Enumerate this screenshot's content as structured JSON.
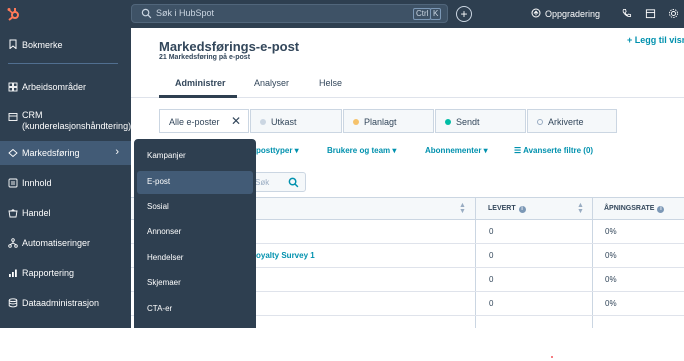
{
  "topbar": {
    "logo_icon": "hubspot-sprocket-icon",
    "search_placeholder": "Søk i HubSpot",
    "shortcut_keys": [
      "Ctrl",
      "K"
    ],
    "upgrade_label": "Oppgradering",
    "icons": [
      "plus-icon",
      "phone-icon",
      "marketplace-icon"
    ]
  },
  "sidebar": {
    "items": [
      {
        "label": "Bokmerke",
        "icon": "bookmark-icon"
      },
      {
        "label": "Arbeidsområder",
        "icon": "workspaces-icon"
      },
      {
        "label": "CRM",
        "label2": "(kunderelasjonshåndtering)",
        "icon": "crm-icon"
      },
      {
        "label": "Markedsføring",
        "icon": "marketing-icon",
        "active": true
      },
      {
        "label": "Innhold",
        "icon": "content-icon"
      },
      {
        "label": "Handel",
        "icon": "commerce-icon"
      },
      {
        "label": "Automatiseringer",
        "icon": "automation-icon"
      },
      {
        "label": "Rapportering",
        "icon": "reporting-icon"
      },
      {
        "label": "Dataadministrasjon",
        "icon": "data-management-icon"
      }
    ]
  },
  "marketing_menu": {
    "items": [
      "Kampanjer",
      "E-post",
      "Sosial",
      "Annonser",
      "Hendelser",
      "Skjemaer",
      "CTA-er"
    ],
    "hovered": "E-post"
  },
  "page": {
    "title": "Markedsførings-e-post",
    "subtitle": "21 Markedsføring på e-post",
    "tabs": [
      "Administrer",
      "Analyser",
      "Helse"
    ],
    "active_tab": "Administrer"
  },
  "view_filters": {
    "chips": [
      {
        "label": "Alle e-poster",
        "active": true
      },
      {
        "label": "Utkast",
        "dot": "#cbd6e2"
      },
      {
        "label": "Planlagt",
        "dot": "#f5c26b"
      },
      {
        "label": "Sendt",
        "dot": "#00bda5"
      },
      {
        "label": "Arkiverte",
        "dot": "hollow"
      }
    ],
    "add_view_label": "Legg til visning"
  },
  "filter_bar": {
    "email_types": "posttyper",
    "users_teams": "Brukere og team",
    "subscriptions": "Abonnementer",
    "advanced": "Avanserte filtre (0)"
  },
  "search": {
    "placeholder": "Søk"
  },
  "table": {
    "columns": [
      "LEVERT",
      "ÅPNINGSRATE"
    ],
    "rows": [
      {
        "name": "",
        "delivered": "0",
        "open_rate": "0%"
      },
      {
        "name": "oyalty Survey 1",
        "delivered": "0",
        "open_rate": "0%"
      },
      {
        "name": "",
        "delivered": "0",
        "open_rate": "0%"
      },
      {
        "name": "",
        "delivered": "0",
        "open_rate": "0%"
      }
    ]
  }
}
